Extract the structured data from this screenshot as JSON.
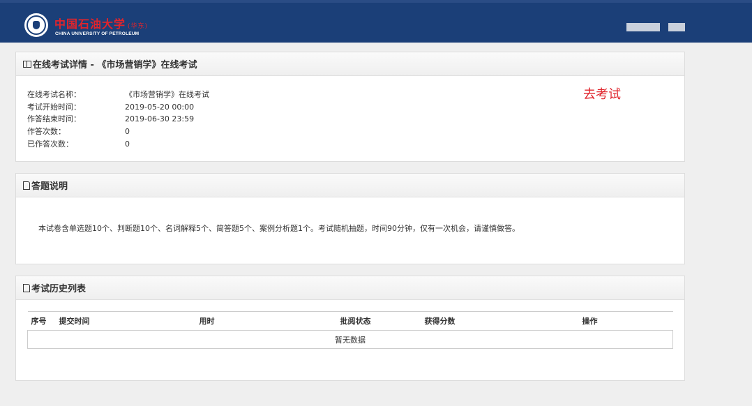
{
  "header": {
    "logo_cn": "中国石油大学",
    "logo_cn_sub": "(华东)",
    "logo_en": "CHINA UNIVERSITY OF PETROLEUM"
  },
  "exam_details": {
    "title": "在线考试详情 - 《市场营销学》在线考试",
    "go_exam_label": "去考试",
    "rows": [
      {
        "label": "在线考试名称：",
        "value": "《市场营销学》在线考试"
      },
      {
        "label": "考试开始时间：",
        "value": "2019-05-20 00:00"
      },
      {
        "label": "作答结束时间：",
        "value": "2019-06-30 23:59"
      },
      {
        "label": "作答次数：",
        "value": "0"
      },
      {
        "label": "已作答次数：",
        "value": "0"
      }
    ]
  },
  "instructions": {
    "title": "答题说明",
    "text": "本试卷含单选题10个、判断题10个、名词解释5个、简答题5个、案例分析题1个。考试随机抽题，时间90分钟，仅有一次机会，请谨慎做答。"
  },
  "history": {
    "title": "考试历史列表",
    "columns": [
      "序号",
      "提交时间",
      "用时",
      "批阅状态",
      "获得分数",
      "操作"
    ],
    "empty_text": "暂无数据"
  }
}
